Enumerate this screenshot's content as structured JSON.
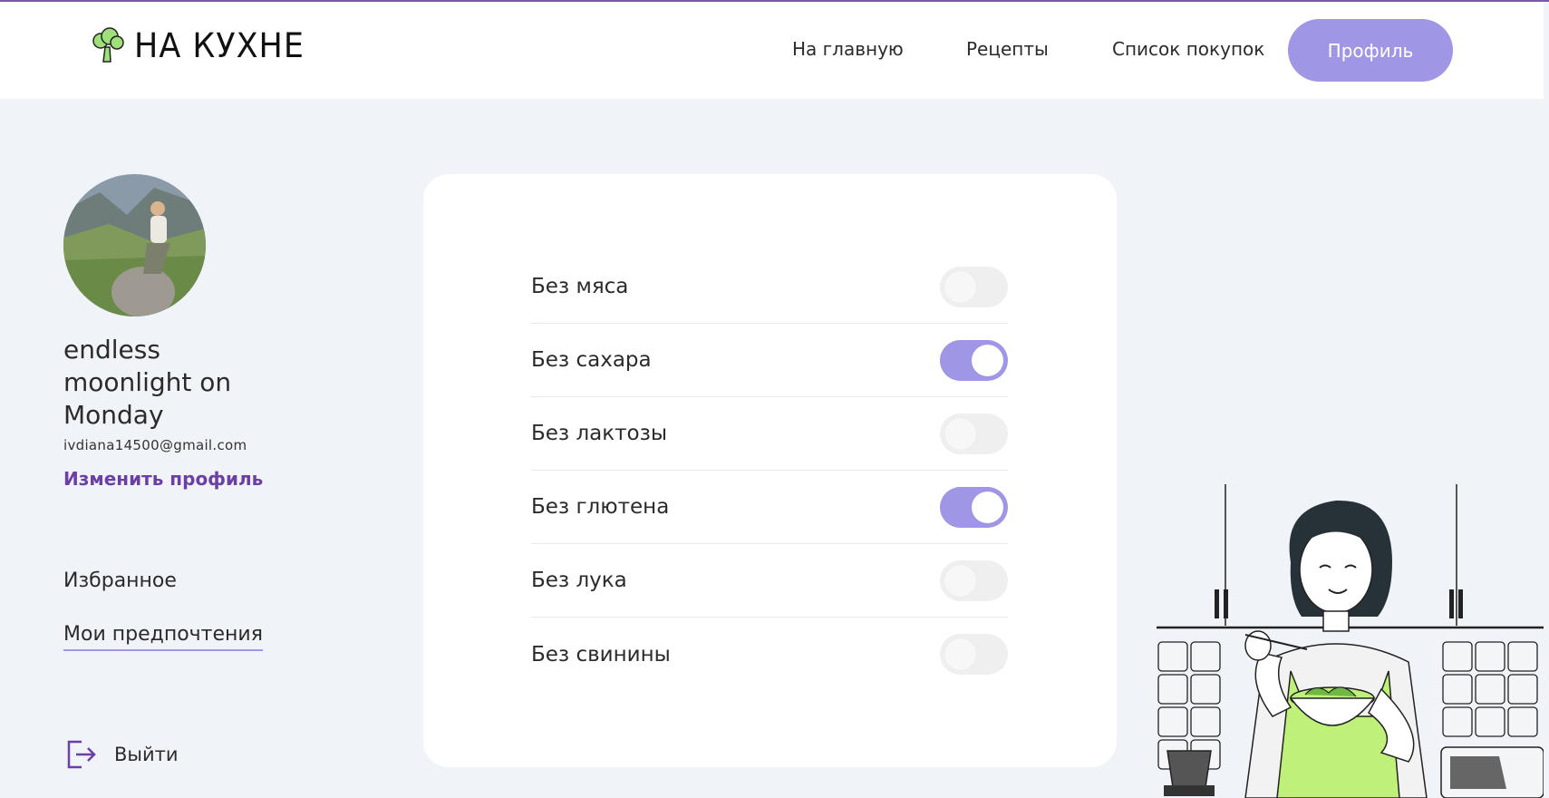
{
  "header": {
    "logo_text": "НА КУХНЕ",
    "nav": [
      {
        "label": "На главную"
      },
      {
        "label": "Рецепты"
      },
      {
        "label": "Список покупок"
      }
    ],
    "profile_button": "Профиль"
  },
  "profile": {
    "name": "endless moonlight on Monday",
    "email": "ivdiana14500@gmail.com",
    "edit_link": "Изменить профиль"
  },
  "sidebar": {
    "items": [
      {
        "label": "Избранное",
        "active": false
      },
      {
        "label": "Мои предпочтения",
        "active": true
      }
    ],
    "logout": "Выйти"
  },
  "preferences": [
    {
      "label": "Без мяса",
      "enabled": false
    },
    {
      "label": "Без сахара",
      "enabled": true
    },
    {
      "label": "Без лактозы",
      "enabled": false
    },
    {
      "label": "Без глютена",
      "enabled": true
    },
    {
      "label": "Без лука",
      "enabled": false
    },
    {
      "label": "Без свинины",
      "enabled": false
    }
  ],
  "colors": {
    "accent": "#9f97e6",
    "link": "#6b3fa6",
    "background": "#f0f3f8"
  }
}
